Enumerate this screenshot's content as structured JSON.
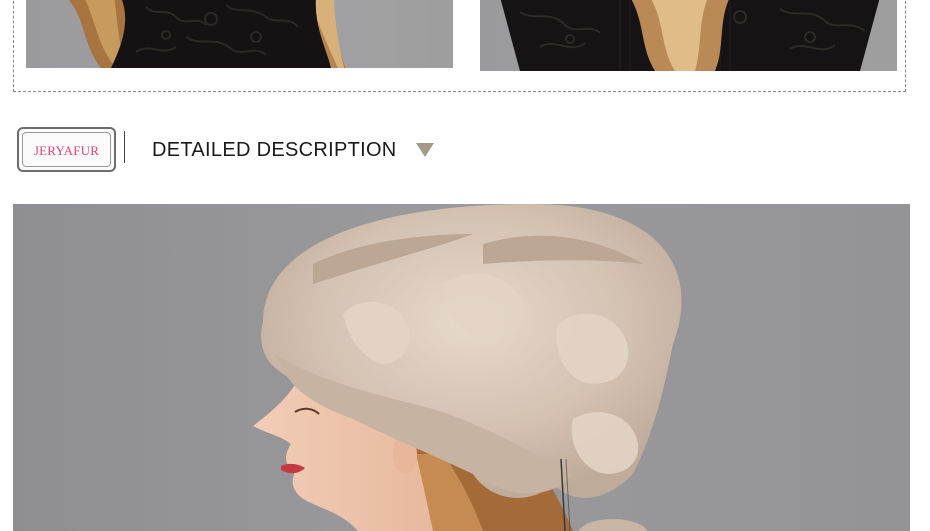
{
  "brand": {
    "logo_text": "JERYAFUR",
    "logo_color": "#e0457b"
  },
  "section": {
    "title": "DETAILED DESCRIPTION",
    "arrow_icon": "triangle-down-icon",
    "arrow_color": "#a39a86"
  },
  "images": {
    "top_left": "model-with-wavy-hair-lace-top",
    "top_right": "model-with-wavy-hair-lace-top",
    "main": "woman-wearing-beige-mink-fur-beret-side-profile"
  },
  "colors": {
    "background": "#ffffff",
    "photo_backdrop": "#9a9a9c",
    "divider": "#444444",
    "frame_dash": "#8a8a8a"
  }
}
